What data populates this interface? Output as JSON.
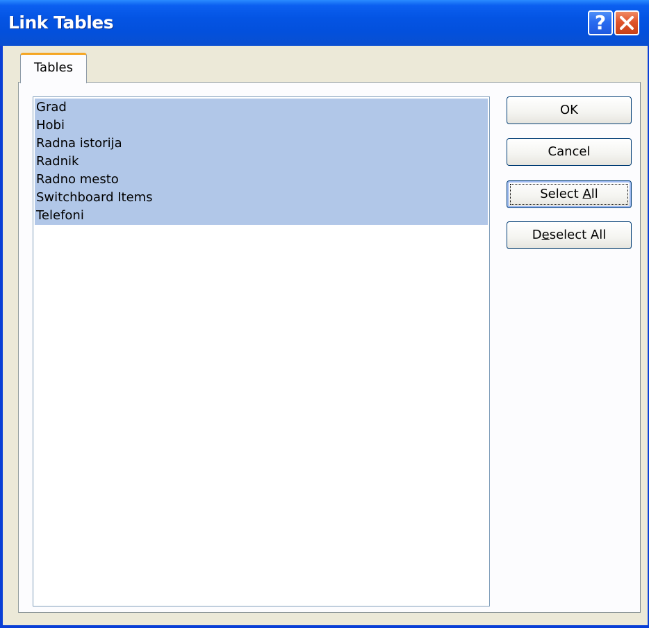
{
  "window": {
    "title": "Link Tables",
    "help_glyph": "?",
    "controls": [
      "help-icon",
      "close-icon"
    ]
  },
  "tabs": [
    {
      "label": "Tables",
      "active": true
    }
  ],
  "tables_list": {
    "items": [
      {
        "label": "Grad",
        "selected": true
      },
      {
        "label": "Hobi",
        "selected": true
      },
      {
        "label": "Radna istorija",
        "selected": true
      },
      {
        "label": "Radnik",
        "selected": true
      },
      {
        "label": "Radno mesto",
        "selected": true
      },
      {
        "label": "Switchboard Items",
        "selected": true
      },
      {
        "label": "Telefoni",
        "selected": true
      }
    ]
  },
  "buttons": {
    "ok": "OK",
    "cancel": "Cancel",
    "select_all": {
      "before": "Select ",
      "mnemonic": "A",
      "after": "ll"
    },
    "deselect_all": {
      "before": "D",
      "mnemonic": "e",
      "after": "select All"
    }
  },
  "colors": {
    "titlebar": "#0454e3",
    "selection": "#b1c7e8",
    "tab_highlight": "#f5a623",
    "dialog_face": "#ece9d8",
    "close_button": "#e0542c"
  }
}
